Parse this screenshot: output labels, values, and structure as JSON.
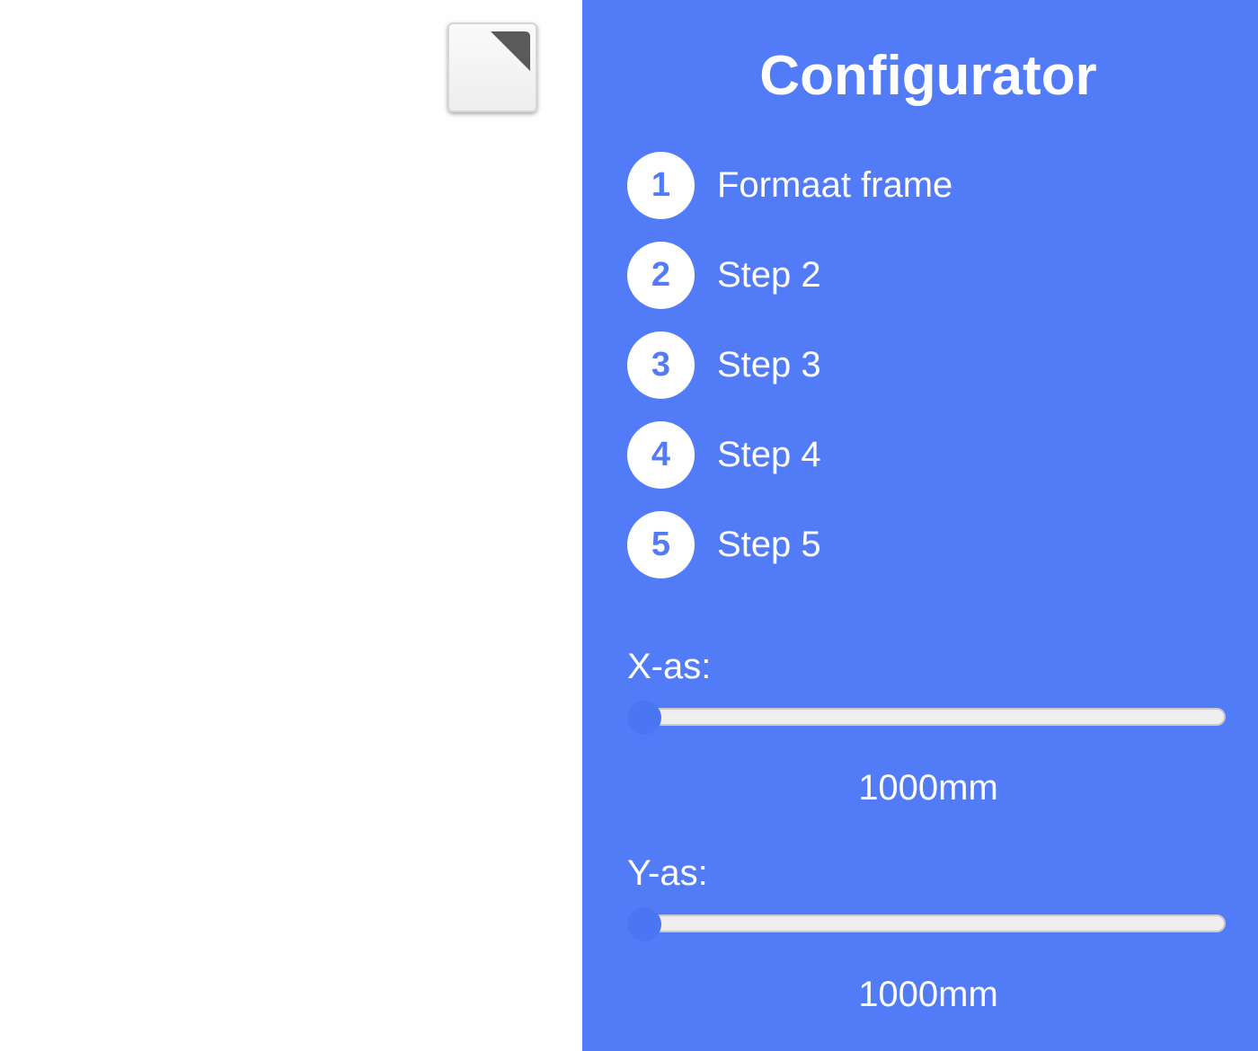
{
  "canvas": {
    "fullscreen_icon": "resize-corner-icon"
  },
  "panel": {
    "title": "Configurator",
    "background_color": "#527cf7",
    "steps": [
      {
        "number": "1",
        "label": "Formaat frame"
      },
      {
        "number": "2",
        "label": "Step 2"
      },
      {
        "number": "3",
        "label": "Step 3"
      },
      {
        "number": "4",
        "label": "Step 4"
      },
      {
        "number": "5",
        "label": "Step 5"
      }
    ],
    "x_axis": {
      "label": "X-as:",
      "value": "1000mm",
      "position": 0
    },
    "y_axis": {
      "label": "Y-as:",
      "value": "1000mm",
      "position": 0
    }
  }
}
